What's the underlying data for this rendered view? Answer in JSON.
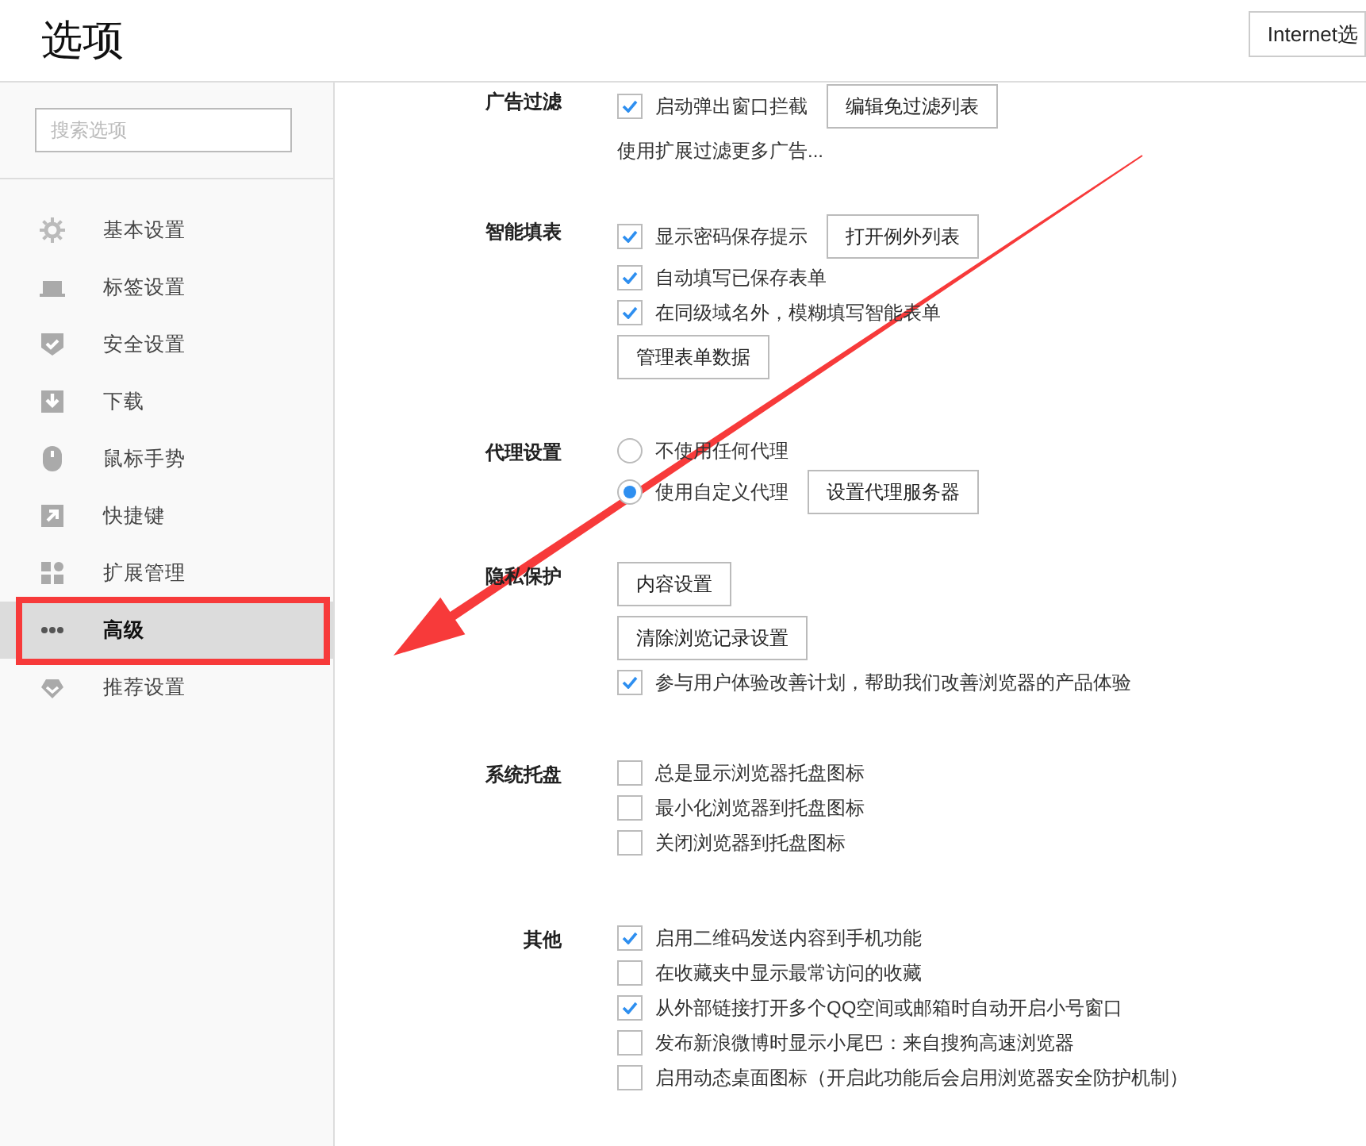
{
  "header": {
    "title": "选项",
    "button": "Internet选"
  },
  "search": {
    "placeholder": "搜索选项"
  },
  "sidebar": {
    "items": [
      {
        "label": "基本设置",
        "selected": false
      },
      {
        "label": "标签设置",
        "selected": false
      },
      {
        "label": "安全设置",
        "selected": false
      },
      {
        "label": "下载",
        "selected": false
      },
      {
        "label": "鼠标手势",
        "selected": false
      },
      {
        "label": "快捷键",
        "selected": false
      },
      {
        "label": "扩展管理",
        "selected": false
      },
      {
        "label": "高级",
        "selected": true
      },
      {
        "label": "推荐设置",
        "selected": false
      }
    ]
  },
  "sections": [
    {
      "label": "广告过滤",
      "rows": [
        {
          "kind": "checkbox",
          "label": "启动弹出窗口拦截",
          "checked": true,
          "button": "编辑免过滤列表"
        },
        {
          "kind": "text",
          "label": "使用扩展过滤更多广告..."
        }
      ]
    },
    {
      "label": "智能填表",
      "rows": [
        {
          "kind": "checkbox",
          "label": "显示密码保存提示",
          "checked": true,
          "button": "打开例外列表"
        },
        {
          "kind": "checkbox",
          "label": "自动填写已保存表单",
          "checked": true
        },
        {
          "kind": "checkbox",
          "label": "在同级域名外，模糊填写智能表单",
          "checked": true
        },
        {
          "kind": "button",
          "label": "管理表单数据"
        }
      ]
    },
    {
      "label": "代理设置",
      "rows": [
        {
          "kind": "radio",
          "label": "不使用任何代理",
          "selected": false
        },
        {
          "kind": "radio",
          "label": "使用自定义代理",
          "selected": true,
          "button": "设置代理服务器"
        }
      ]
    },
    {
      "label": "隐私保护",
      "rows": [
        {
          "kind": "button",
          "label": "内容设置"
        },
        {
          "kind": "button",
          "label": "清除浏览记录设置"
        },
        {
          "kind": "checkbox",
          "label": "参与用户体验改善计划，帮助我们改善浏览器的产品体验",
          "checked": true
        }
      ]
    },
    {
      "label": "系统托盘",
      "rows": [
        {
          "kind": "checkbox",
          "label": "总是显示浏览器托盘图标",
          "checked": false
        },
        {
          "kind": "checkbox",
          "label": "最小化浏览器到托盘图标",
          "checked": false
        },
        {
          "kind": "checkbox",
          "label": "关闭浏览器到托盘图标",
          "checked": false
        }
      ]
    },
    {
      "label": "其他",
      "rows": [
        {
          "kind": "checkbox",
          "label": "启用二维码发送内容到手机功能",
          "checked": true
        },
        {
          "kind": "checkbox",
          "label": "在收藏夹中显示最常访问的收藏",
          "checked": false
        },
        {
          "kind": "checkbox",
          "label": "从外部链接打开多个QQ空间或邮箱时自动开启小号窗口",
          "checked": true
        },
        {
          "kind": "checkbox",
          "label": "发布新浪微博时显示小尾巴：来自搜狗高速浏览器",
          "checked": false
        },
        {
          "kind": "checkbox",
          "label": "启用动态桌面图标（开启此功能后会启用浏览器安全防护机制）",
          "checked": false
        }
      ]
    }
  ]
}
